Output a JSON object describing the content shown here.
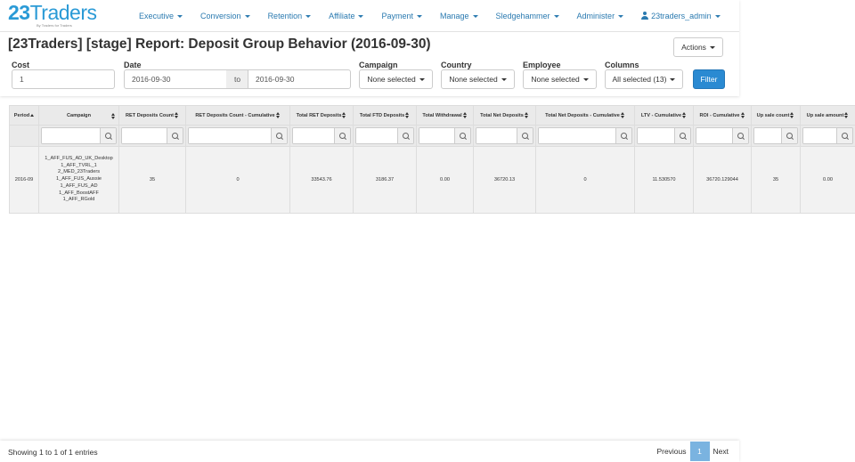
{
  "brand": {
    "logo_num": "23",
    "logo_text": "Traders",
    "tagline": "By Traders for Traders"
  },
  "nav": [
    {
      "label": "Executive"
    },
    {
      "label": "Conversion"
    },
    {
      "label": "Retention"
    },
    {
      "label": "Affiliate"
    },
    {
      "label": "Payment"
    },
    {
      "label": "Manage"
    },
    {
      "label": "Sledgehammer"
    },
    {
      "label": "Administer"
    }
  ],
  "user": {
    "name": "23traders_admin"
  },
  "page": {
    "title": "[23Traders] [stage] Report: Deposit Group Behavior (2016-09-30)",
    "actions_label": "Actions"
  },
  "filters": {
    "cost_label": "Cost",
    "cost_value": "1",
    "date_label": "Date",
    "date_from": "2016-09-30",
    "date_to_label": "to",
    "date_to": "2016-09-30",
    "campaign_label": "Campaign",
    "campaign_value": "None selected",
    "country_label": "Country",
    "country_value": "None selected",
    "employee_label": "Employee",
    "employee_value": "None selected",
    "columns_label": "Columns",
    "columns_value": "All selected (13)",
    "filter_button": "Filter"
  },
  "table": {
    "headers": [
      "Period",
      "Campaign",
      "RET Deposits Count",
      "RET Deposits Count - Cumulative",
      "Total RET Deposits",
      "Total FTD Deposits",
      "Total Withdrawal",
      "Total Net Deposits",
      "Total Net Deposits - Cumulative",
      "LTV - Cumulative",
      "ROI - Cumulative",
      "Up sale count",
      "Up sale amount"
    ],
    "row": {
      "period": "2016-09",
      "campaigns": [
        "1_AFF_FUS_AD_UK_Desktop",
        "1_AFF_TVRL_1",
        "2_MED_23Traders",
        "1_AFF_FUS_Aussie",
        "1_AFF_FUS_AD",
        "1_AFF_BoostAFF",
        "1_AFF_RGold"
      ],
      "ret_deposits_count": "35",
      "ret_deposits_cumulative": "0",
      "total_ret_deposits": "33543.76",
      "total_ftd_deposits": "3186.37",
      "total_withdrawal": "0.00",
      "total_net_deposits": "36720.13",
      "total_net_deposits_cumulative": "0",
      "ltv_cumulative": "11.530570",
      "roi_cumulative": "36720.129044",
      "up_sale_count": "35",
      "up_sale_amount": "0.00"
    }
  },
  "footer": {
    "info": "Showing 1 to 1 of 1 entries",
    "prev": "Previous",
    "page": "1",
    "next": "Next"
  },
  "icons": [
    "caret-down-icon",
    "user-icon",
    "sort-icon",
    "sort-asc-icon",
    "search-icon"
  ],
  "colors": {
    "brand_blue": "#2a9ad6",
    "nav_link": "#2a7ab0",
    "filter_button": "#2a8ad2",
    "page_active": "#7ab3e0"
  }
}
